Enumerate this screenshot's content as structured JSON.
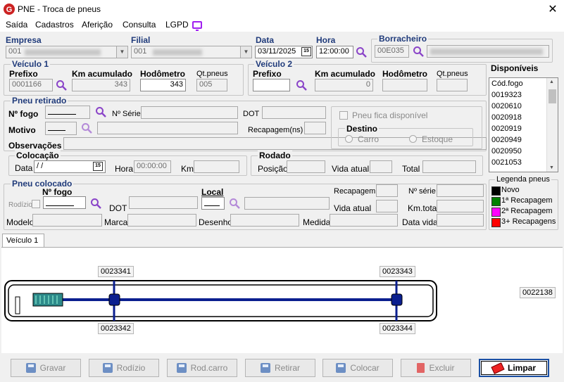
{
  "window": {
    "title": "PNE - Troca de pneus",
    "close": "✕"
  },
  "menu": [
    "Saída",
    "Cadastros",
    "Aferição",
    "Consulta",
    "LGPD"
  ],
  "header": {
    "empresa_label": "Empresa",
    "empresa_value": "001",
    "filial_label": "Filial",
    "filial_value": "001",
    "data_label": "Data",
    "data_value": "03/11/2025",
    "hora_label": "Hora",
    "hora_value": "12:00:00",
    "borracheiro_label": "Borracheiro",
    "borracheiro_value": "00E035"
  },
  "veiculo1": {
    "title": "Veículo 1",
    "prefixo_label": "Prefixo",
    "prefixo_value": "0001166",
    "km_label": "Km acumulado",
    "km_value": "343",
    "hodometro_label": "Hodômetro",
    "hodometro_value": "343",
    "qtpneus_label": "Qt.pneus",
    "qtpneus_value": "005"
  },
  "veiculo2": {
    "title": "Veículo 2",
    "prefixo_label": "Prefixo",
    "prefixo_value": "",
    "km_label": "Km acumulado",
    "km_value": "0",
    "hodometro_label": "Hodômetro",
    "hodometro_value": "",
    "qtpneus_label": "Qt.pneus",
    "qtpneus_value": ""
  },
  "disponiveis": {
    "title": "Disponíveis",
    "items": [
      "Cód.fogo",
      "0019323",
      "0020610",
      "0020918",
      "0020919",
      "0020949",
      "0020950",
      "0021053"
    ]
  },
  "retirado": {
    "title": "Pneu retirado",
    "nfogo_label": "Nº fogo",
    "nserie_label": "Nº Série",
    "dot_label": "DOT",
    "motivo_label": "Motivo",
    "recap_label": "Recapagem(ns)",
    "obs_label": "Observações",
    "fica_label": "Pneu fica disponível",
    "destino_title": "Destino",
    "carro_label": "Carro",
    "estoque_label": "Estoque"
  },
  "colocacao": {
    "title": "Colocação",
    "data_label": "Data",
    "data_value": " /  /",
    "hora_label": "Hora",
    "hora_value": "00:00:00",
    "km_label": "Km"
  },
  "rodado": {
    "title": "Rodado",
    "posicao_label": "Posição",
    "vida_label": "Vida atual",
    "total_label": "Total"
  },
  "colocado": {
    "title": "Pneu colocado",
    "nfogo_label": "Nº fogo",
    "local_label": "Local",
    "recap_label": "Recapagem",
    "nserie_label": "Nº série",
    "rodizio_label": "Rodízio",
    "dot_label": "DOT",
    "vida_label": "Vida atual",
    "kmtotal_label": "Km.total",
    "modelo_label": "Modelo",
    "marca_label": "Marca",
    "desenho_label": "Desenho",
    "medida_label": "Medida",
    "datavida_label": "Data vida"
  },
  "legenda": {
    "title": "Legenda pneus",
    "items": [
      {
        "label": "Novo",
        "color": "#000000"
      },
      {
        "label": "1ª Recapagem",
        "color": "#008000"
      },
      {
        "label": "2ª Recapagem",
        "color": "#ff00ff"
      },
      {
        "label": "3+ Recapagens",
        "color": "#ff0000"
      }
    ]
  },
  "tab": {
    "label": "Veículo 1"
  },
  "tires": {
    "front_top": "0023341",
    "front_bottom": "0023342",
    "rear_top": "0023343",
    "rear_bottom": "0023344",
    "spare": "0022138"
  },
  "buttons": {
    "gravar": "Gravar",
    "rodizio": "Rodízio",
    "rodcarro": "Rod.carro",
    "retirar": "Retirar",
    "colocar": "Colocar",
    "excluir": "Excluir",
    "limpar": "Limpar"
  },
  "colors": {
    "accent": "#1f3a7a",
    "axle": "#0b1f8f",
    "lgpd": "#a020f0",
    "logo": "#cc2222"
  }
}
